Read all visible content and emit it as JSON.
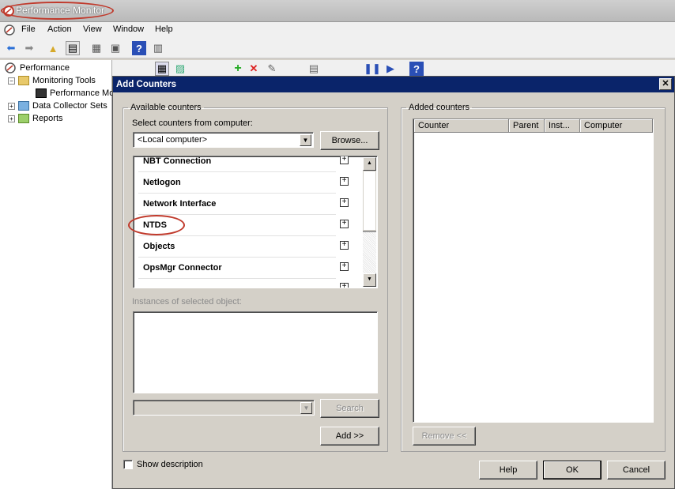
{
  "app": {
    "title": "Performance Monitor"
  },
  "menu": [
    "File",
    "Action",
    "View",
    "Window",
    "Help"
  ],
  "tree": {
    "root": "Performance",
    "items": [
      "Monitoring Tools",
      "Performance Mo",
      "Data Collector Sets",
      "Reports"
    ]
  },
  "dialog": {
    "title": "Add Counters",
    "close": "✕",
    "available": {
      "legend": "Available counters",
      "computer_label": "Select counters from computer:",
      "computer_value": "<Local computer>",
      "browse": "Browse...",
      "objects": [
        "NBT Connection",
        "Netlogon",
        "Network Interface",
        "NTDS",
        "Objects",
        "OpsMgr Connector"
      ],
      "instances_label": "Instances of selected object:",
      "search": "Search",
      "add": "Add >>"
    },
    "added": {
      "legend": "Added counters",
      "columns": [
        "Counter",
        "Parent",
        "Inst...",
        "Computer"
      ],
      "remove": "Remove <<"
    },
    "show_description": "Show description",
    "help": "Help",
    "ok": "OK",
    "cancel": "Cancel"
  },
  "colors": {
    "highlight_ellipse": "#c0392b",
    "dialog_title_bg": "#0a246a"
  }
}
